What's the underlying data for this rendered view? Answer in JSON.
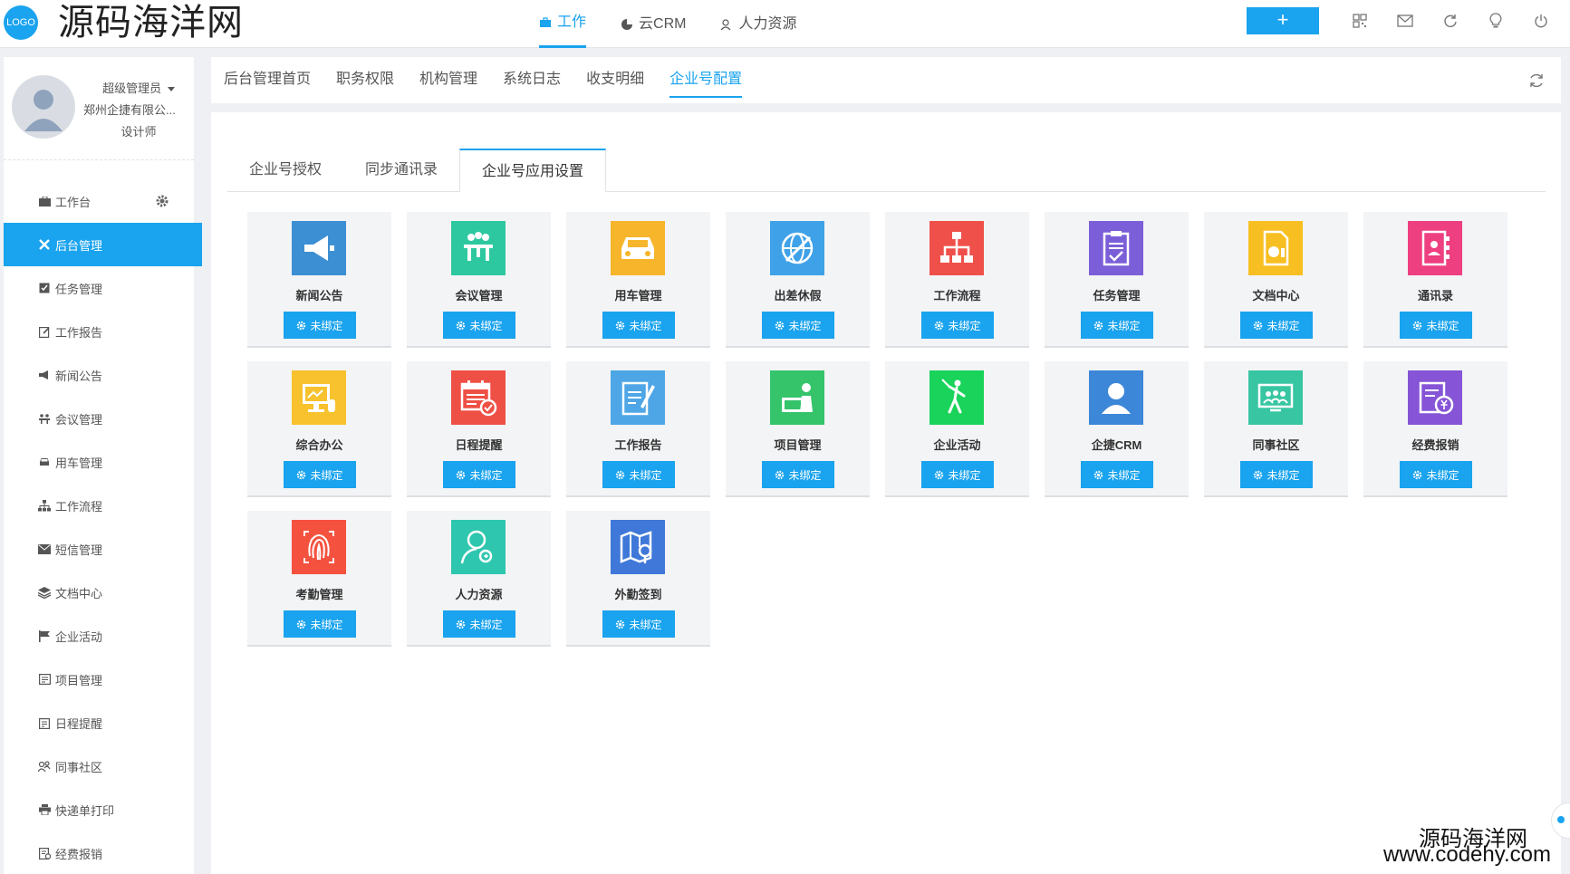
{
  "header": {
    "logo_text": "LOGO",
    "brand": "源码海洋网",
    "nav": [
      {
        "label": "工作",
        "icon": "briefcase-icon",
        "active": true
      },
      {
        "label": "云CRM",
        "icon": "pie-chart-icon",
        "active": false
      },
      {
        "label": "人力资源",
        "icon": "users-icon",
        "active": false
      }
    ],
    "add_label": "+",
    "icons": [
      "qrcode-icon",
      "mail-icon",
      "refresh-icon",
      "lightbulb-icon",
      "power-icon"
    ]
  },
  "profile": {
    "name": "超级管理员",
    "company": "郑州企捷有限公...",
    "role": "设计师"
  },
  "sidebar": {
    "items": [
      {
        "label": "工作台",
        "icon": "dashboard-icon",
        "active": false
      },
      {
        "label": "后台管理",
        "icon": "tools-icon",
        "active": true
      },
      {
        "label": "任务管理",
        "icon": "checkbox-icon",
        "active": false
      },
      {
        "label": "工作报告",
        "icon": "edit-icon",
        "active": false
      },
      {
        "label": "新闻公告",
        "icon": "megaphone-icon",
        "active": false
      },
      {
        "label": "会议管理",
        "icon": "meeting-icon",
        "active": false
      },
      {
        "label": "用车管理",
        "icon": "car-icon",
        "active": false
      },
      {
        "label": "工作流程",
        "icon": "sitemap-icon",
        "active": false
      },
      {
        "label": "短信管理",
        "icon": "envelope-icon",
        "active": false
      },
      {
        "label": "文档中心",
        "icon": "layers-icon",
        "active": false
      },
      {
        "label": "企业活动",
        "icon": "flag-icon",
        "active": false
      },
      {
        "label": "项目管理",
        "icon": "project-icon",
        "active": false
      },
      {
        "label": "日程提醒",
        "icon": "calendar-icon",
        "active": false
      },
      {
        "label": "同事社区",
        "icon": "community-icon",
        "active": false
      },
      {
        "label": "快递单打印",
        "icon": "print-icon",
        "active": false
      },
      {
        "label": "经费报销",
        "icon": "receipt-icon",
        "active": false
      }
    ]
  },
  "tabbar": {
    "tabs": [
      "后台管理首页",
      "职务权限",
      "机构管理",
      "系统日志",
      "收支明细",
      "企业号配置"
    ],
    "active_index": 5
  },
  "subtabs": {
    "tabs": [
      "企业号授权",
      "同步通讯录",
      "企业号应用设置"
    ],
    "active_index": 2
  },
  "apps": [
    {
      "name": "新闻公告",
      "icon": "megaphone-icon",
      "color": "#3d8fd4",
      "button": "未绑定"
    },
    {
      "name": "会议管理",
      "icon": "meeting-icon",
      "color": "#2ec8a0",
      "button": "未绑定"
    },
    {
      "name": "用车管理",
      "icon": "car-icon",
      "color": "#f7b52b",
      "button": "未绑定"
    },
    {
      "name": "出差休假",
      "icon": "globe-plane-icon",
      "color": "#3fa2e8",
      "button": "未绑定"
    },
    {
      "name": "工作流程",
      "icon": "sitemap-icon",
      "color": "#f0504a",
      "button": "未绑定"
    },
    {
      "name": "任务管理",
      "icon": "clipboard-icon",
      "color": "#7b5fd8",
      "button": "未绑定"
    },
    {
      "name": "文档中心",
      "icon": "document-chart-icon",
      "color": "#f7bf22",
      "button": "未绑定"
    },
    {
      "name": "通讯录",
      "icon": "contacts-book-icon",
      "color": "#ee3f80",
      "button": "未绑定"
    },
    {
      "name": "综合办公",
      "icon": "monitor-icon",
      "color": "#f7c22d",
      "button": "未绑定"
    },
    {
      "name": "日程提醒",
      "icon": "calendar-check-icon",
      "color": "#ef5045",
      "button": "未绑定"
    },
    {
      "name": "工作报告",
      "icon": "report-pen-icon",
      "color": "#4ea6e6",
      "button": "未绑定"
    },
    {
      "name": "项目管理",
      "icon": "presenter-icon",
      "color": "#35c46a",
      "button": "未绑定"
    },
    {
      "name": "企业活动",
      "icon": "golfer-icon",
      "color": "#19d35a",
      "button": "未绑定"
    },
    {
      "name": "企捷CRM",
      "icon": "person-icon",
      "color": "#3d87d8",
      "button": "未绑定"
    },
    {
      "name": "同事社区",
      "icon": "community-screen-icon",
      "color": "#38c6a2",
      "button": "未绑定"
    },
    {
      "name": "经费报销",
      "icon": "expense-icon",
      "color": "#8654d6",
      "button": "未绑定"
    },
    {
      "name": "考勤管理",
      "icon": "fingerprint-icon",
      "color": "#f4523f",
      "button": "未绑定"
    },
    {
      "name": "人力资源",
      "icon": "user-search-icon",
      "color": "#2ec6ae",
      "button": "未绑定"
    },
    {
      "name": "外勤签到",
      "icon": "map-pin-icon",
      "color": "#3f78d8",
      "button": "未绑定"
    }
  ],
  "watermark": {
    "line1": "源码海洋网",
    "line2": "www.codehy.com"
  }
}
